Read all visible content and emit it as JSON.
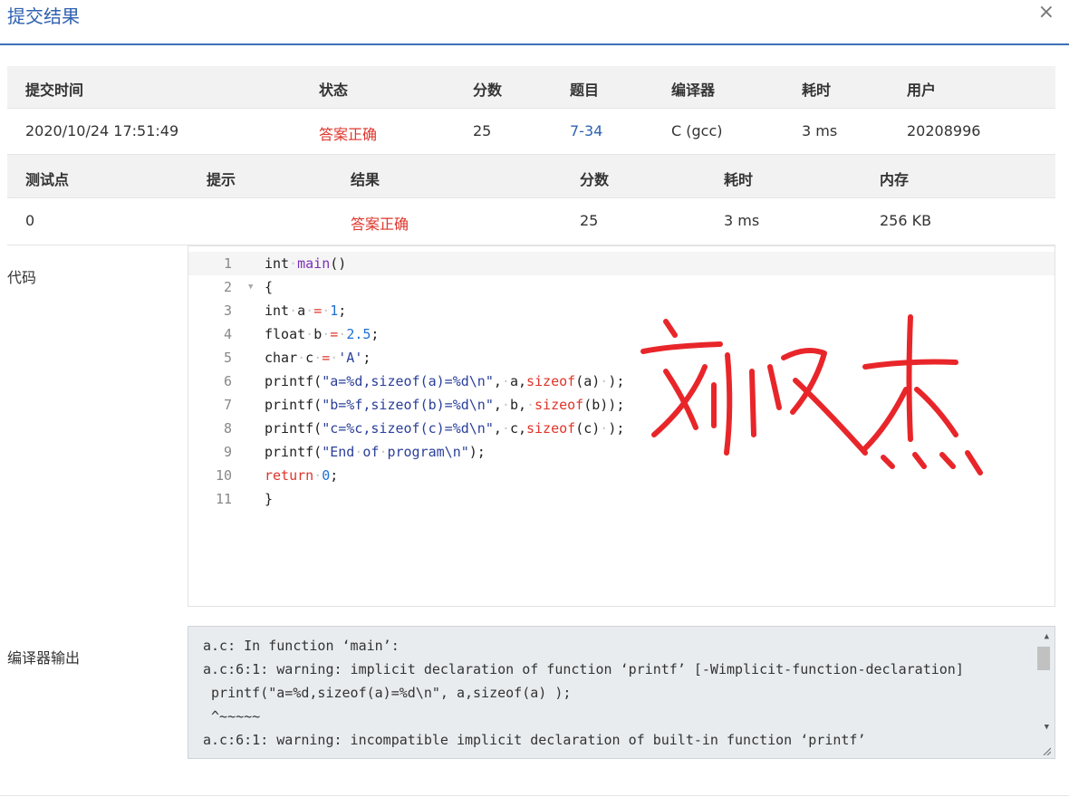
{
  "dialog": {
    "title": "提交结果",
    "close_symbol": "×"
  },
  "submission": {
    "headers": [
      "提交时间",
      "状态",
      "分数",
      "题目",
      "编译器",
      "耗时",
      "用户"
    ],
    "row": {
      "time": "2020/10/24 17:51:49",
      "status": "答案正确",
      "score": "25",
      "problem": "7-34",
      "compiler": "C (gcc)",
      "elapsed": "3 ms",
      "user": "20208996"
    }
  },
  "testcases": {
    "headers": [
      "测试点",
      "提示",
      "结果",
      "分数",
      "耗时",
      "内存"
    ],
    "row": {
      "id": "0",
      "hint": "",
      "result": "答案正确",
      "score": "25",
      "elapsed": "3 ms",
      "memory": "256 KB"
    }
  },
  "code_section": {
    "label": "代码",
    "line_numbers": [
      "1",
      "2",
      "3",
      "4",
      "5",
      "6",
      "7",
      "8",
      "9",
      "10",
      "11"
    ]
  },
  "compiler_output": {
    "label": "编译器输出",
    "lines": [
      "a.c: In function ‘main’:",
      "a.c:6:1: warning: implicit declaration of function ‘printf’ [-Wimplicit-function-declaration]",
      " printf(\"a=%d,sizeof(a)=%d\\n\", a,sizeof(a) );",
      " ^~~~~~",
      "a.c:6:1: warning: incompatible implicit declaration of built-in function ‘printf’"
    ]
  },
  "handwritten_signature": "刘汶杰",
  "colors": {
    "accent": "#2f62b2",
    "success_red": "#e0342a",
    "signature_red": "#e8262a"
  }
}
